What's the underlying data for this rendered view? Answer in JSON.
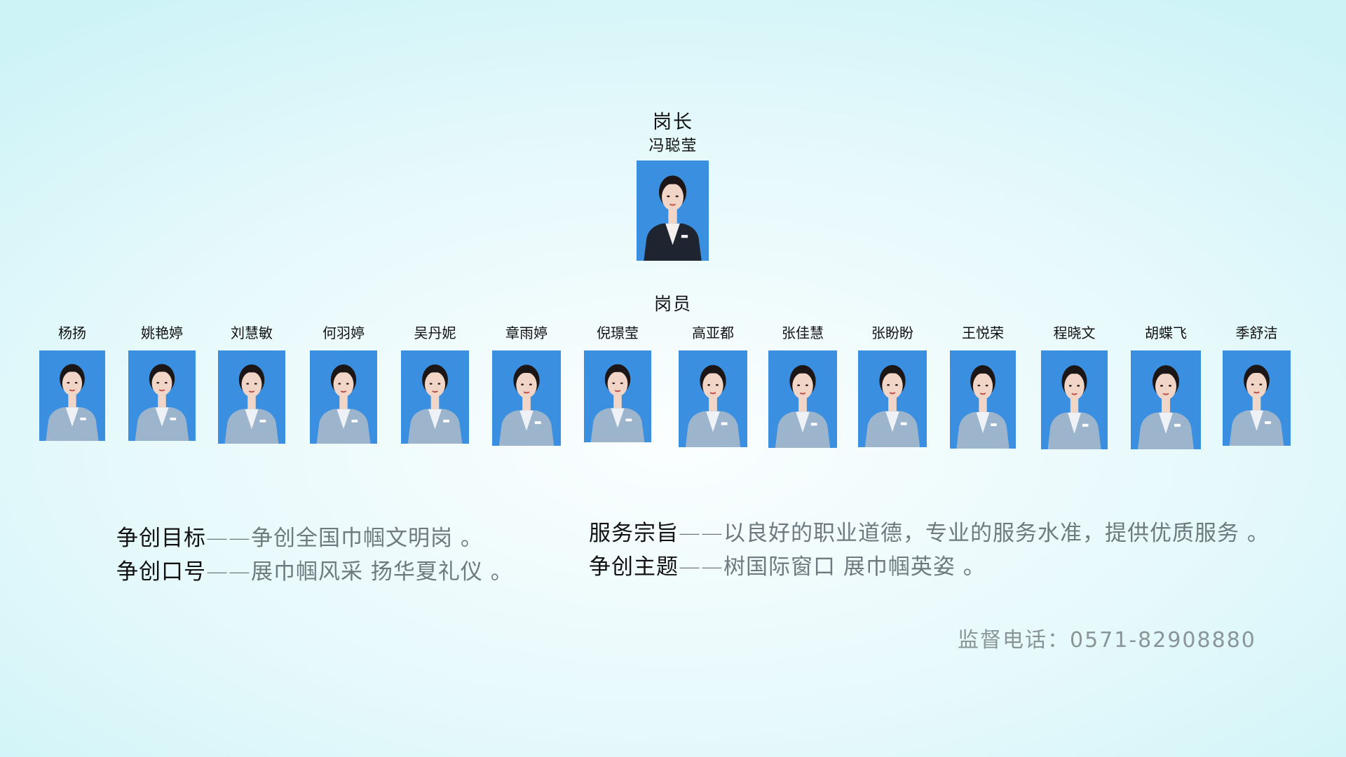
{
  "leader": {
    "title": "岗长",
    "name": "冯聪莹"
  },
  "staff": {
    "title": "岗员",
    "members": [
      "杨扬",
      "姚艳婷",
      "刘慧敏",
      "何羽婷",
      "吴丹妮",
      "章雨婷",
      "倪璟莹",
      "高亚都",
      "张佳慧",
      "张盼盼",
      "王悦荣",
      "程晓文",
      "胡蝶飞",
      "季舒洁"
    ]
  },
  "slogans_left": [
    {
      "label": "争创目标",
      "text": "——争创全国巾帼文明岗 。"
    },
    {
      "label": "争创口号",
      "text": "——展巾帼风采 扬华夏礼仪 。"
    }
  ],
  "slogans_right": [
    {
      "label": "服务宗旨",
      "text": "——以良好的职业道德，专业的服务水准，提供优质服务 。"
    },
    {
      "label": "争创主题",
      "text": "——树国际窗口 展巾帼英姿 。"
    }
  ],
  "hotline": "监督电话：0571-82908880",
  "colors": {
    "photo_background": "#3a8fe0",
    "leader_suit": "#1e2430",
    "staff_suit": "#9cb4cc",
    "hair": "#1c1716",
    "skin": "#f1d6c8"
  }
}
